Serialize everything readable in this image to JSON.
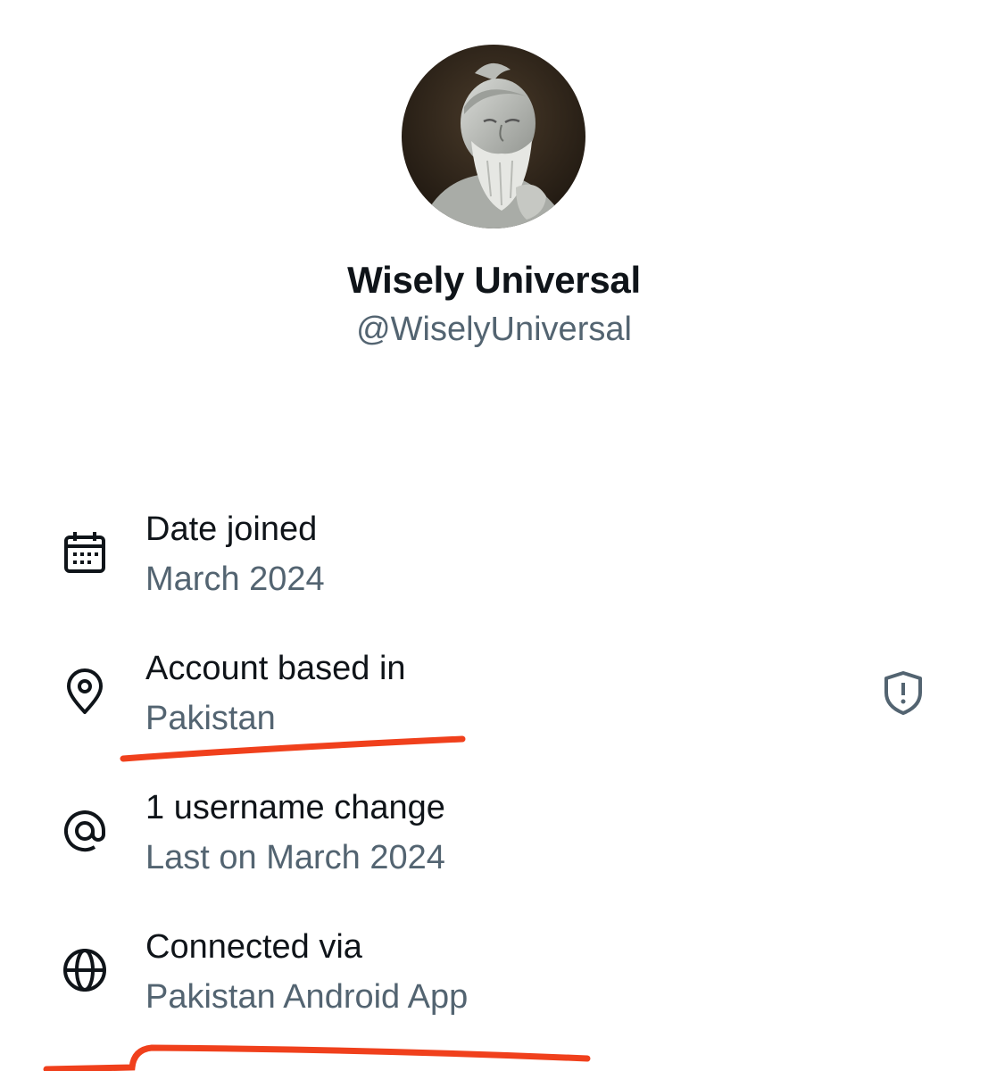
{
  "profile": {
    "display_name": "Wisely Universal",
    "handle": "@WiselyUniversal",
    "avatar_desc": "avatar"
  },
  "about": {
    "items": [
      {
        "icon": "calendar-icon",
        "title": "Date joined",
        "value": "March 2024"
      },
      {
        "icon": "location-pin-icon",
        "title": "Account based in",
        "value": "Pakistan",
        "trailing_icon": "shield-alert-icon"
      },
      {
        "icon": "at-sign-icon",
        "title": "1 username change",
        "value": "Last on March 2024"
      },
      {
        "icon": "globe-icon",
        "title": "Connected via",
        "value": "Pakistan Android App"
      }
    ]
  },
  "colors": {
    "primary_text": "#0f1419",
    "secondary_text": "#536471",
    "annotation_red": "#f0401c"
  }
}
